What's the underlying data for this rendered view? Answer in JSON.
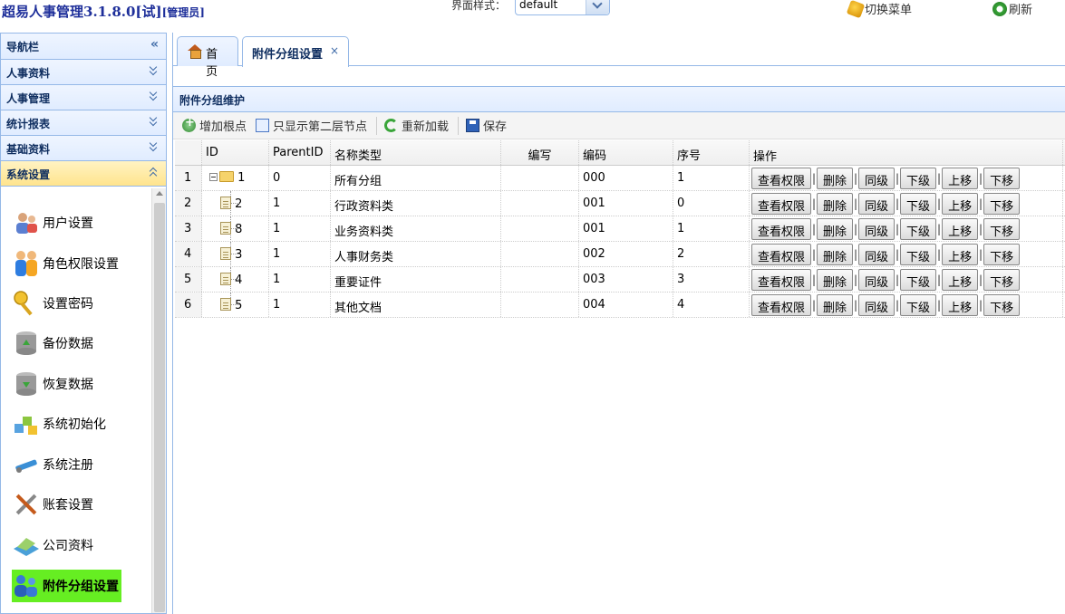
{
  "header": {
    "app_title": "超易人事管理3.1.8.0[试]",
    "role": "[管理员]",
    "skin_label": "界面样式：",
    "skin_value": "default",
    "switch_menu": "切换菜单",
    "refresh": "刷新"
  },
  "sidebar": {
    "title": "导航栏",
    "collapse_icon": "«",
    "sections": [
      {
        "label": "人事资料"
      },
      {
        "label": "人事管理"
      },
      {
        "label": "统计报表"
      },
      {
        "label": "基础资料"
      },
      {
        "label": "系统设置"
      }
    ],
    "menu": [
      {
        "label": "用户设置",
        "icon": "users-icon"
      },
      {
        "label": "角色权限设置",
        "icon": "roles-icon"
      },
      {
        "label": "设置密码",
        "icon": "key-icon"
      },
      {
        "label": "备份数据",
        "icon": "backup-db-icon"
      },
      {
        "label": "恢复数据",
        "icon": "restore-db-icon"
      },
      {
        "label": "系统初始化",
        "icon": "init-icon"
      },
      {
        "label": "系统注册",
        "icon": "register-icon"
      },
      {
        "label": "账套设置",
        "icon": "tools-icon"
      },
      {
        "label": "公司资料",
        "icon": "company-icon"
      },
      {
        "label": "附件分组设置",
        "icon": "group-icon"
      }
    ]
  },
  "tabs": [
    {
      "label": "首页"
    },
    {
      "label": "附件分组设置",
      "close": "×"
    }
  ],
  "panel": {
    "title": "附件分组维护",
    "toolbar": {
      "add_root": "增加根点",
      "show_second_level": "只显示第二层节点",
      "reload": "重新加载",
      "save": "保存"
    }
  },
  "grid": {
    "columns": [
      "ID",
      "ParentID",
      "名称类型",
      "编写",
      "编码",
      "序号",
      "操作"
    ],
    "actions": [
      "查看权限",
      "删除",
      "同级",
      "下级",
      "上移",
      "下移"
    ],
    "action_sep": "|",
    "rows": [
      {
        "num": "1",
        "id": "1",
        "parent": "0",
        "name": "所有分组",
        "code": "000",
        "seq": "1"
      },
      {
        "num": "2",
        "id": "2",
        "parent": "1",
        "name": "行政资料类",
        "code": "001",
        "seq": "0"
      },
      {
        "num": "3",
        "id": "8",
        "parent": "1",
        "name": "业务资料类",
        "code": "001",
        "seq": "1"
      },
      {
        "num": "4",
        "id": "3",
        "parent": "1",
        "name": "人事财务类",
        "code": "002",
        "seq": "2"
      },
      {
        "num": "5",
        "id": "4",
        "parent": "1",
        "name": "重要证件",
        "code": "003",
        "seq": "3"
      },
      {
        "num": "6",
        "id": "5",
        "parent": "1",
        "name": "其他文档",
        "code": "004",
        "seq": "4"
      }
    ]
  }
}
